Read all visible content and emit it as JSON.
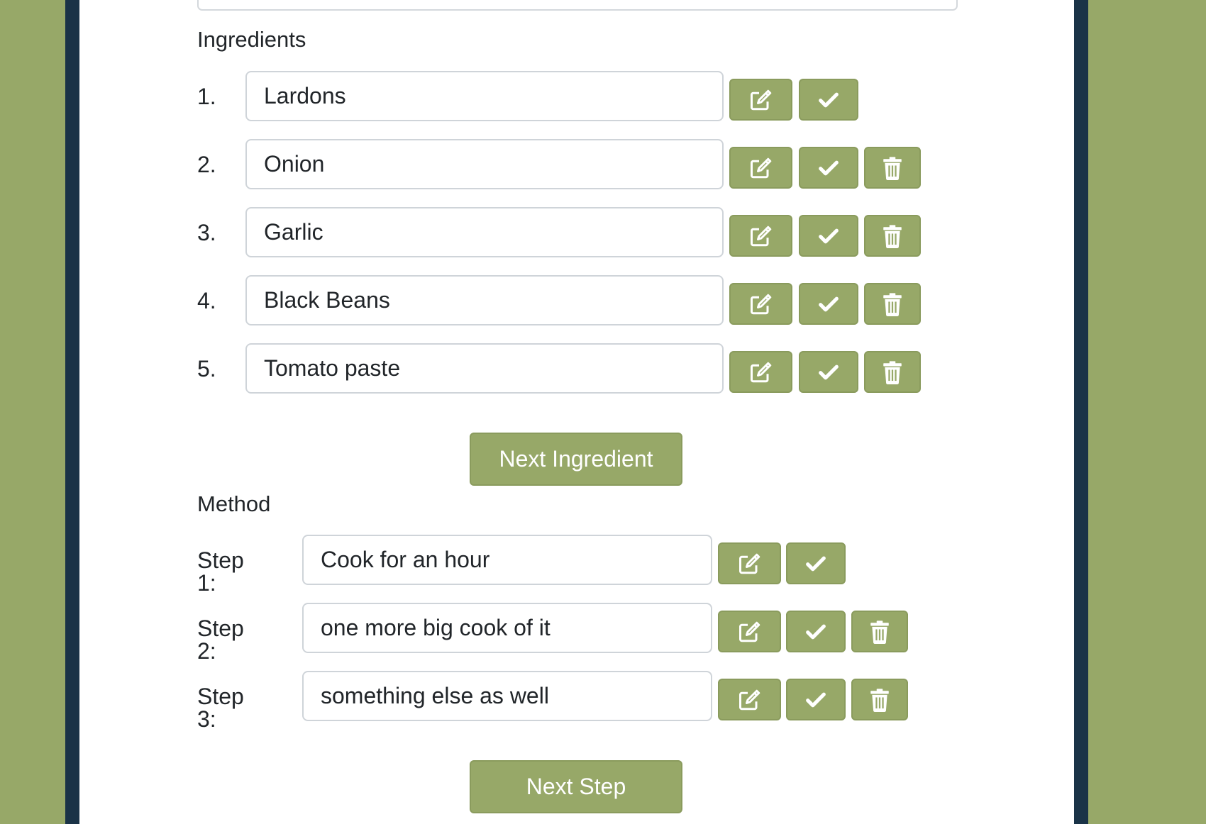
{
  "ingredients": {
    "label": "Ingredients",
    "items": [
      {
        "num": "1.",
        "value": "Lardons"
      },
      {
        "num": "2.",
        "value": "Onion"
      },
      {
        "num": "3.",
        "value": "Garlic"
      },
      {
        "num": "4.",
        "value": "Black Beans"
      },
      {
        "num": "5.",
        "value": "Tomato paste"
      }
    ],
    "next_label": "Next Ingredient"
  },
  "method": {
    "label": "Method",
    "steps": [
      {
        "num": "Step 1:",
        "value": "Cook for an hour"
      },
      {
        "num": "Step 2:",
        "value": "one more big cook of it"
      },
      {
        "num": "Step 3:",
        "value": "something else as well"
      }
    ],
    "next_label": "Next Step"
  },
  "icons": {
    "edit": "edit-icon",
    "check": "check-icon",
    "trash": "trash-icon"
  },
  "colors": {
    "accent": "#97a868",
    "frame": "#1a3347",
    "card": "#ffffff"
  }
}
